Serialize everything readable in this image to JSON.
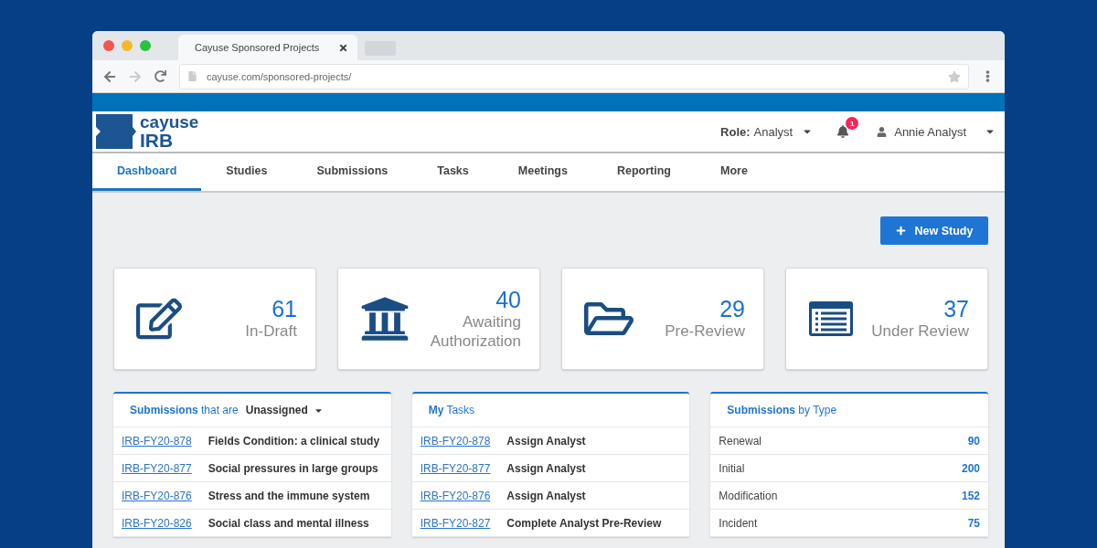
{
  "browser": {
    "tab_title": "Cayuse Sponsored Projects",
    "url": "cayuse.com/sponsored-projects/"
  },
  "header": {
    "logo_top": "cayuse",
    "logo_bottom": "IRB",
    "role_label": "Role:",
    "role_value": "Analyst",
    "notification_count": "1",
    "user_name": "Annie Analyst"
  },
  "nav": [
    {
      "label": "Dashboard",
      "selected": true
    },
    {
      "label": "Studies",
      "selected": false
    },
    {
      "label": "Submissions",
      "selected": false
    },
    {
      "label": "Tasks",
      "selected": false
    },
    {
      "label": "Meetings",
      "selected": false
    },
    {
      "label": "Reporting",
      "selected": false
    },
    {
      "label": "More",
      "selected": false
    }
  ],
  "new_study_button": "New Study",
  "stats": [
    {
      "kind": "draft",
      "count": "61",
      "label": "In-Draft"
    },
    {
      "kind": "authorization",
      "count": "40",
      "label": "Awaiting Authorization"
    },
    {
      "kind": "prereview",
      "count": "29",
      "label": "Pre-Review"
    },
    {
      "kind": "review",
      "count": "37",
      "label": "Under Review"
    }
  ],
  "panels": [
    {
      "kind": "links",
      "title": "**Submissions** that are",
      "filter": "Unassigned",
      "rows": [
        {
          "id": "IRB-FY20-878",
          "text": "Fields Condition: a clinical study"
        },
        {
          "id": "IRB-FY20-877",
          "text": "Social pressures in large groups"
        },
        {
          "id": "IRB-FY20-876",
          "text": "Stress and the immune system"
        },
        {
          "id": "IRB-FY20-826",
          "text": "Social class and mental illness"
        }
      ]
    },
    {
      "kind": "links",
      "title": "**My** Tasks",
      "rows": [
        {
          "id": "IRB-FY20-878",
          "text": "Assign Analyst"
        },
        {
          "id": "IRB-FY20-877",
          "text": "Assign Analyst"
        },
        {
          "id": "IRB-FY20-876",
          "text": "Assign Analyst"
        },
        {
          "id": "IRB-FY20-827",
          "text": "Complete Analyst Pre-Review"
        }
      ]
    },
    {
      "kind": "counts",
      "title": "**Submissions** by Type",
      "rows": [
        {
          "text": "Renewal",
          "count": "90"
        },
        {
          "text": "Initial",
          "count": "200"
        },
        {
          "text": "Modification",
          "count": "152"
        },
        {
          "text": "Incident",
          "count": "75"
        }
      ]
    }
  ]
}
